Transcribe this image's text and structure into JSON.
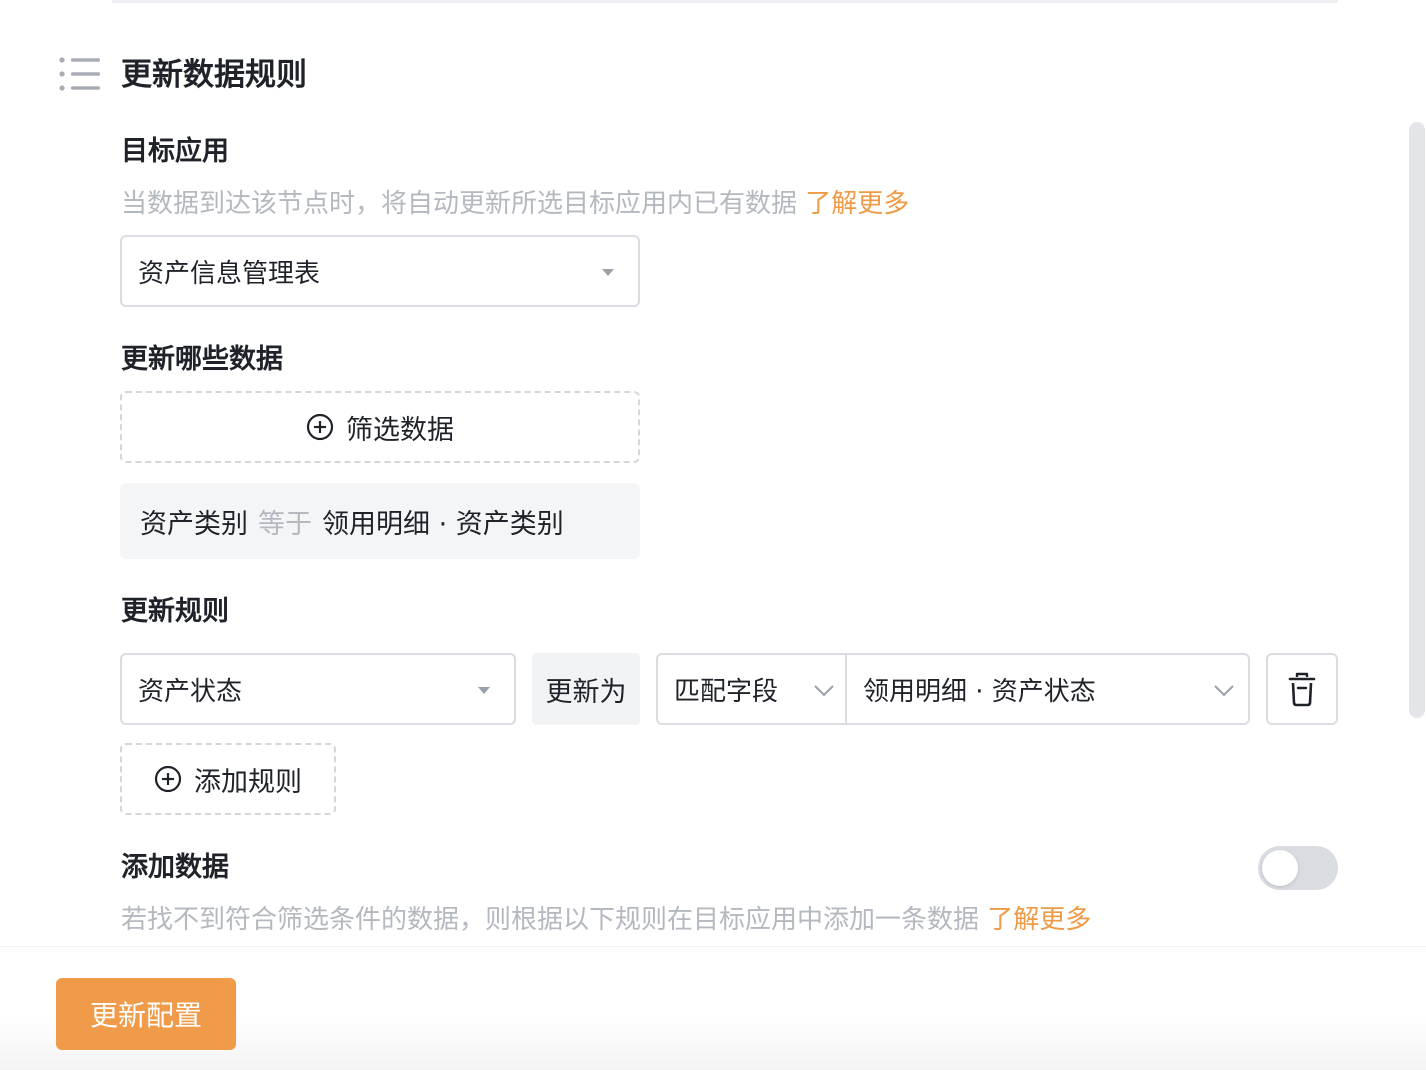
{
  "section": {
    "title": "更新数据规则",
    "icon": "list-icon"
  },
  "target_app": {
    "label": "目标应用",
    "description": "当数据到达该节点时，将自动更新所选目标应用内已有数据",
    "learn_more": "了解更多",
    "selected": "资产信息管理表"
  },
  "which_data": {
    "label": "更新哪些数据",
    "filter_button": "筛选数据",
    "condition": {
      "field": "资产类别",
      "operator": "等于",
      "value": "领用明细 · 资产类别"
    }
  },
  "update_rules": {
    "label": "更新规则",
    "rule": {
      "field": "资产状态",
      "action": "更新为",
      "mode": "匹配字段",
      "value": "领用明细 · 资产状态"
    },
    "add_button": "添加规则"
  },
  "add_data": {
    "label": "添加数据",
    "description": "若找不到符合筛选条件的数据，则根据以下规则在目标应用中添加一条数据",
    "learn_more": "了解更多",
    "enabled": false
  },
  "footer": {
    "primary_button": "更新配置"
  },
  "colors": {
    "accent": "#ef9b4a",
    "link": "#ef9a45",
    "muted_text": "#b4b8bf"
  }
}
